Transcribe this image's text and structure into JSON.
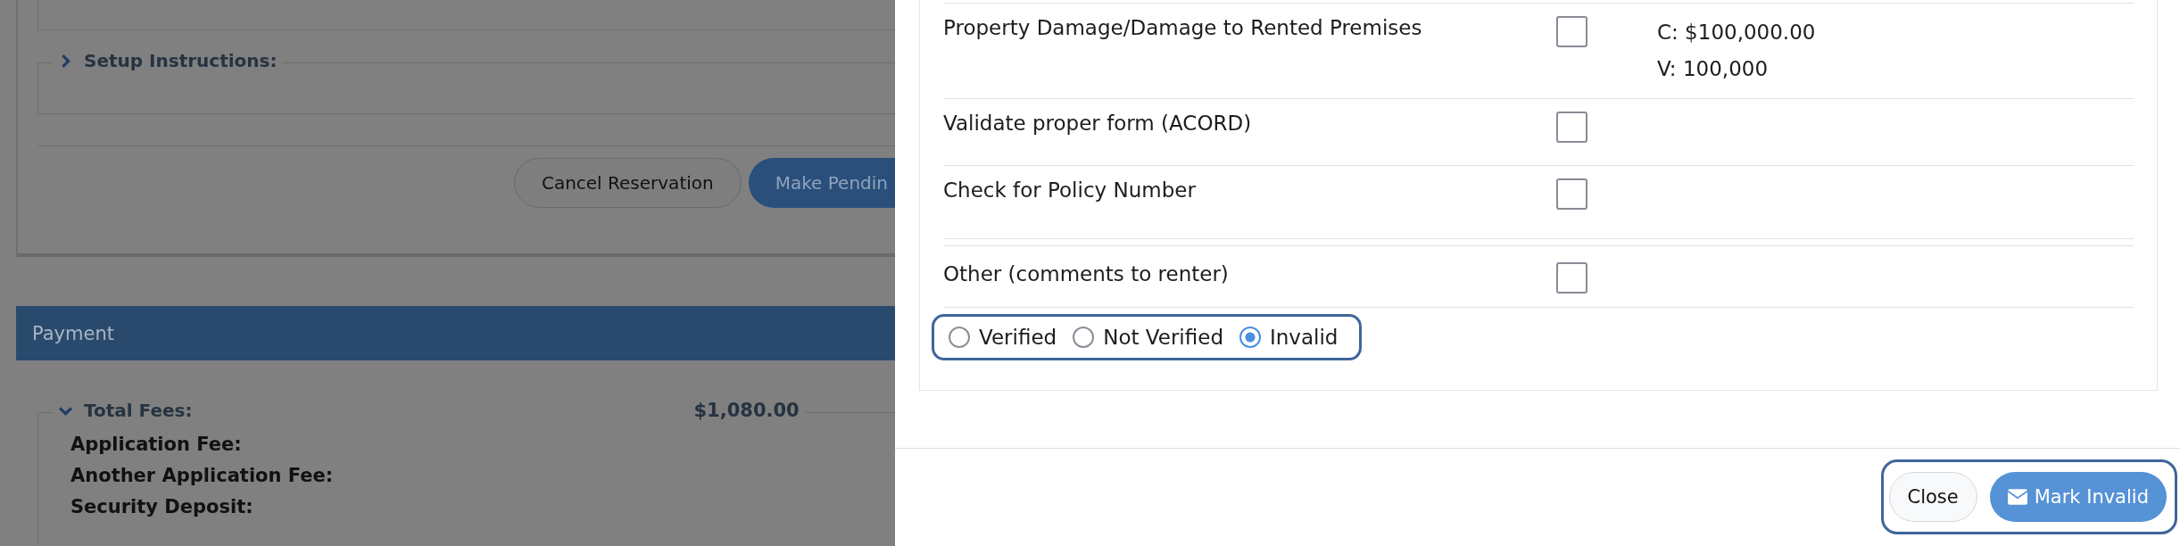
{
  "background_page": {
    "setup_instructions": {
      "label": "Setup Instructions:",
      "expanded": false
    },
    "buttons": [
      {
        "label": "Cancel Reservation",
        "kind": "secondary"
      },
      {
        "label": "Make Pendin",
        "kind": "primary"
      }
    ],
    "payment": {
      "title": "Payment",
      "total_fees": {
        "label": "Total Fees:",
        "amount": "$1,080.00",
        "expanded": true
      },
      "fee_items": [
        "Application Fee:",
        "Another Application Fee:",
        "Security Deposit:"
      ]
    }
  },
  "modal": {
    "checklist": [
      {
        "label": "Property Damage/Damage to Rented Premises",
        "checked": false,
        "values": [
          "C: $100,000.00",
          "V: 100,000"
        ]
      },
      {
        "label": "Validate proper form (ACORD)",
        "checked": false
      },
      {
        "label": "Check for Policy Number",
        "checked": false
      },
      {
        "label": "Other (comments to renter)",
        "checked": false
      }
    ],
    "status_options": [
      {
        "label": "Verified",
        "selected": false
      },
      {
        "label": "Not Verified",
        "selected": false
      },
      {
        "label": "Invalid",
        "selected": true
      }
    ],
    "buttons": [
      {
        "label": "Close",
        "kind": "secondary"
      },
      {
        "label": "Mark Invalid",
        "kind": "primary"
      }
    ]
  }
}
